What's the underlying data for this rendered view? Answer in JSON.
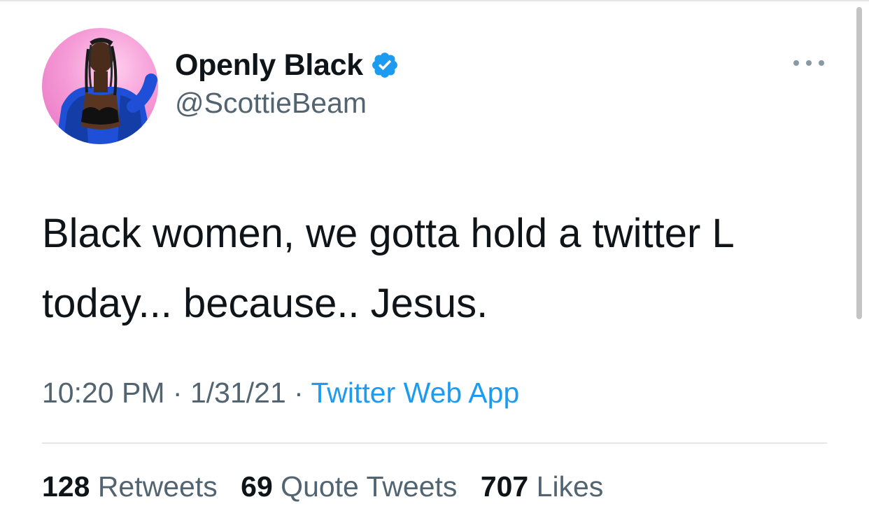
{
  "author": {
    "display_name": "Openly Black",
    "handle": "@ScottieBeam",
    "verified": true,
    "avatar_icon": "profile-photo"
  },
  "tweet": {
    "text": "Black women, we gotta hold a twitter L today... because.. Jesus.",
    "time": "10:20 PM",
    "date": "1/31/21",
    "separator": "·",
    "source": "Twitter Web App"
  },
  "stats": {
    "retweets_count": "128",
    "retweets_label": "Retweets",
    "quotes_count": "69",
    "quotes_label": "Quote Tweets",
    "likes_count": "707",
    "likes_label": "Likes"
  },
  "colors": {
    "text": "#0f1419",
    "secondary": "#536471",
    "link": "#1d9bf0",
    "verified": "#1d9bf0"
  }
}
